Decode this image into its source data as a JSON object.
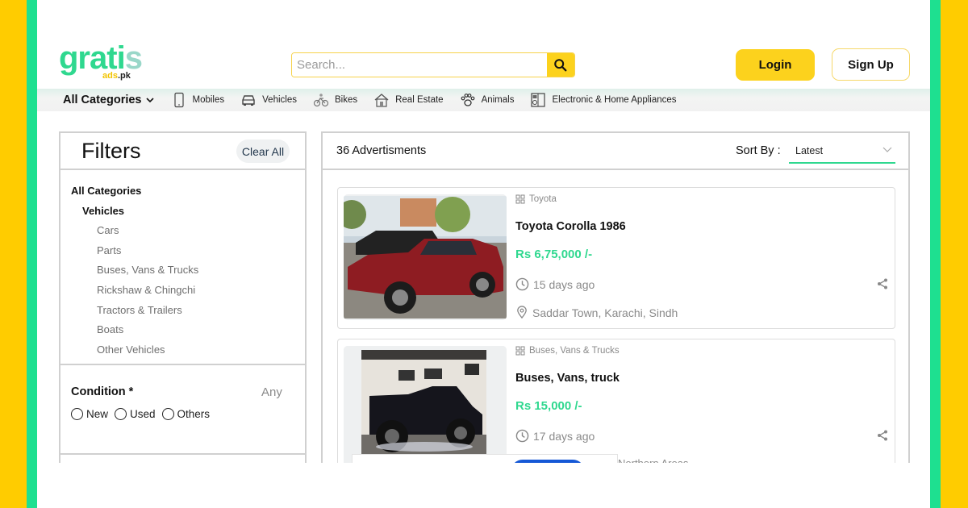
{
  "brand": {
    "logo_main": "grati",
    "logo_accent": "s",
    "logo_sub_a": "ads",
    "logo_sub_b": ".pk"
  },
  "colors": {
    "primary_yellow": "#fcd21d",
    "accent_green": "#2fd88f",
    "frame_yellow": "#ffcc00",
    "frame_green": "#1ee090"
  },
  "search": {
    "placeholder": "Search...",
    "value": "",
    "icon": "search-icon"
  },
  "auth": {
    "login_label": "Login",
    "signup_label": "Sign Up"
  },
  "nav": {
    "all_categories": "All Categories",
    "items": [
      {
        "label": "Mobiles",
        "icon": "mobile-icon"
      },
      {
        "label": "Vehicles",
        "icon": "car-icon"
      },
      {
        "label": "Bikes",
        "icon": "bike-icon"
      },
      {
        "label": "Real Estate",
        "icon": "house-icon"
      },
      {
        "label": "Animals",
        "icon": "paw-icon"
      },
      {
        "label": "Electronic & Home Appliances",
        "icon": "appliance-icon"
      }
    ]
  },
  "filters": {
    "title": "Filters",
    "clear_all": "Clear All",
    "all_categories": "All Categories",
    "selected_category": "Vehicles",
    "subcategories": [
      "Cars",
      "Parts",
      "Buses, Vans & Trucks",
      "Rickshaw & Chingchi",
      "Tractors & Trailers",
      "Boats",
      "Other Vehicles"
    ],
    "condition": {
      "label": "Condition *",
      "value": "Any",
      "options": [
        "New",
        "Used",
        "Others"
      ]
    }
  },
  "results": {
    "count_label": "36 Advertisments",
    "sort_label": "Sort By :",
    "sort_value": "Latest",
    "listings": [
      {
        "category": "Toyota",
        "title": "Toyota Corolla 1986",
        "price": "Rs 6,75,000 /-",
        "posted": "15 days ago",
        "location": "Saddar Town, Karachi, Sindh",
        "image": "red Toyota Corolla sedan"
      },
      {
        "category": "Buses, Vans & Trucks",
        "title": "Buses, Vans, truck",
        "price": "Rs 15,000 /-",
        "posted": "17 days ago",
        "location": "Northern Areas",
        "image": "black lifted pickup truck"
      }
    ]
  }
}
